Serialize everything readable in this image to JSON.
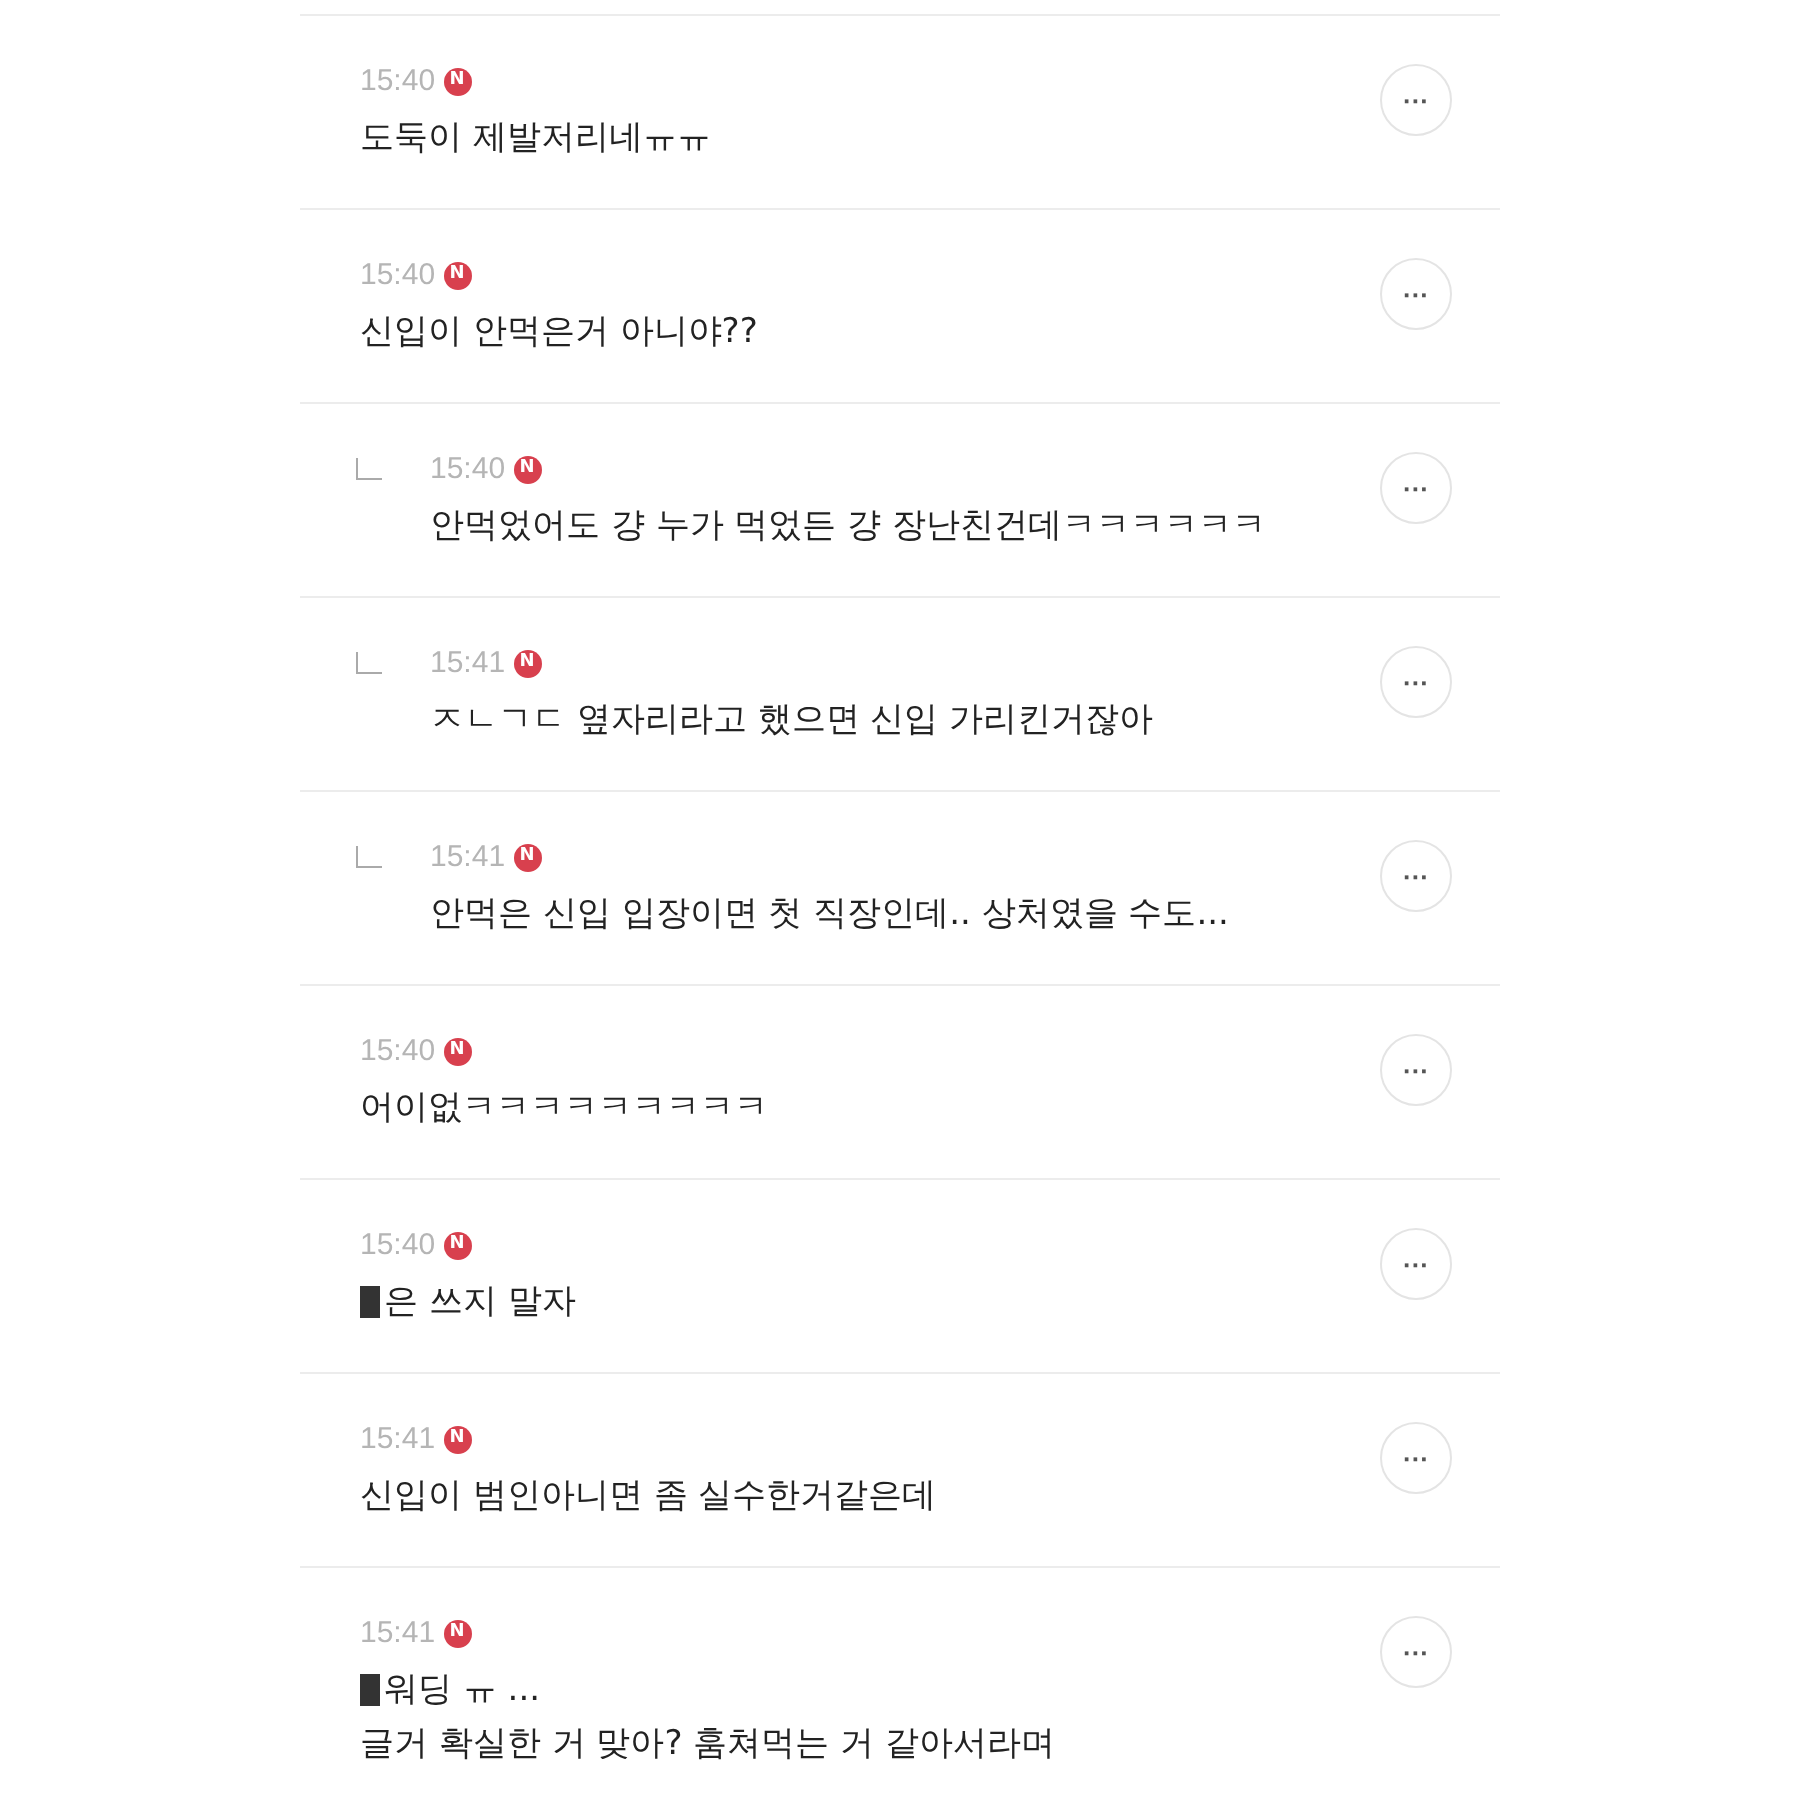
{
  "comments": [
    {
      "reply": false,
      "time": "15:40",
      "badge": "N",
      "redacted": false,
      "lines": [
        "도둑이 제발저리네ㅠㅠ"
      ]
    },
    {
      "reply": false,
      "time": "15:40",
      "badge": "N",
      "redacted": false,
      "lines": [
        "신입이 안먹은거 아니야??"
      ]
    },
    {
      "reply": true,
      "time": "15:40",
      "badge": "N",
      "redacted": false,
      "lines": [
        "안먹었어도 걍 누가 먹었든 걍 장난친건데ㅋㅋㅋㅋㅋㅋ"
      ]
    },
    {
      "reply": true,
      "time": "15:41",
      "badge": "N",
      "redacted": false,
      "lines": [
        "ㅈㄴㄱㄷ 옆자리라고 했으면 신입 가리킨거잖아"
      ]
    },
    {
      "reply": true,
      "time": "15:41",
      "badge": "N",
      "redacted": false,
      "lines": [
        "안먹은 신입 입장이면 첫 직장인데.. 상처였을 수도..."
      ]
    },
    {
      "reply": false,
      "time": "15:40",
      "badge": "N",
      "redacted": false,
      "lines": [
        "어이없ㅋㅋㅋㅋㅋㅋㅋㅋㅋ"
      ]
    },
    {
      "reply": false,
      "time": "15:40",
      "badge": "N",
      "redacted": true,
      "lines": [
        "은 쓰지 말자"
      ]
    },
    {
      "reply": false,
      "time": "15:41",
      "badge": "N",
      "redacted": false,
      "lines": [
        "신입이 범인아니면 좀 실수한거같은데"
      ]
    },
    {
      "reply": false,
      "time": "15:41",
      "badge": "N",
      "redacted": true,
      "lines": [
        "워딩 ㅠ ...",
        "글거 확실한 거 맞아?  훔쳐먹는 거 같아서라며"
      ]
    }
  ],
  "more_button": "···"
}
